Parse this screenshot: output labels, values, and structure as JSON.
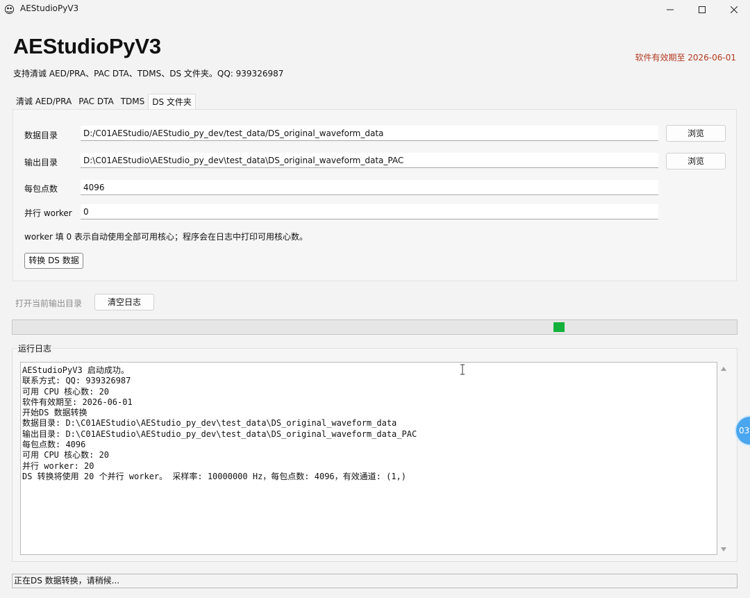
{
  "window": {
    "title": "AEStudioPyV3",
    "icons": {
      "app": "app-logo-icon",
      "minimize": "minimize-icon",
      "maximize": "maximize-icon",
      "close": "close-icon"
    }
  },
  "header": {
    "title": "AEStudioPyV3",
    "subtitle": "支持清诚 AED/PRA、PAC DTA、TDMS、DS 文件夹。QQ: 939326987",
    "license": "软件有效期至 2026-06-01"
  },
  "tabs": [
    {
      "label": "清诚 AED/PRA",
      "active": false
    },
    {
      "label": "PAC DTA",
      "active": false
    },
    {
      "label": "TDMS",
      "active": false
    },
    {
      "label": "DS 文件夹",
      "active": true
    }
  ],
  "form": {
    "data_dir": {
      "label": "数据目录",
      "value": "D:/C01AEStudio/AEStudio_py_dev/test_data/DS_original_waveform_data",
      "browse_label": "浏览"
    },
    "output_dir": {
      "label": "输出目录",
      "value": "D:\\C01AEStudio\\AEStudio_py_dev\\test_data\\DS_original_waveform_data_PAC",
      "browse_label": "浏览"
    },
    "points_per_packet": {
      "label": "每包点数",
      "value": "4096"
    },
    "workers": {
      "label": "并行 worker",
      "value": "0"
    },
    "hint": "worker 填 0 表示自动使用全部可用核心；程序会在日志中打印可用核心数。",
    "convert_label": "转换 DS 数据"
  },
  "actions": {
    "open_output_label": "打开当前输出目录",
    "clear_log_label": "清空日志"
  },
  "progress": {
    "mode": "indeterminate",
    "chunk_color": "#13b13b"
  },
  "log": {
    "title": "运行日志",
    "lines": [
      "AEStudioPyV3 启动成功。",
      "联系方式: QQ: 939326987",
      "可用 CPU 核心数: 20",
      "软件有效期至: 2026-06-01",
      "开始DS 数据转换",
      "数据目录: D:\\C01AEStudio\\AEStudio_py_dev\\test_data\\DS_original_waveform_data",
      "输出目录: D:\\C01AEStudio\\AEStudio_py_dev\\test_data\\DS_original_waveform_data_PAC",
      "每包点数: 4096",
      "可用 CPU 核心数: 20",
      "并行 worker: 20",
      "DS 转换将使用 20 个并行 worker。 采样率: 10000000 Hz，每包点数: 4096，有效通道: (1,)"
    ]
  },
  "floating_widget": {
    "text": "03"
  },
  "status": {
    "text": "正在DS 数据转换，请稍候..."
  },
  "colors": {
    "license": "#b43a22",
    "accent_green": "#13b13b",
    "disabled_text": "#8c8c8c"
  }
}
